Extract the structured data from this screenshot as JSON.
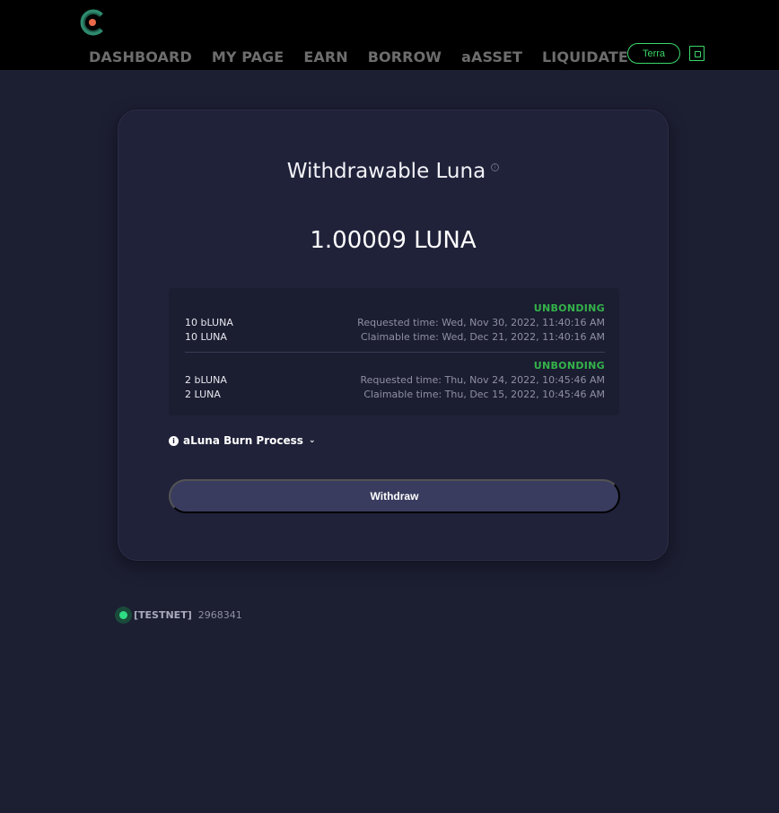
{
  "header": {
    "nav": [
      "DASHBOARD",
      "MY PAGE",
      "EARN",
      "BORROW",
      "aASSET",
      "LIQUIDATE"
    ],
    "network_button": "Terra",
    "accent_color": "#3ad86a"
  },
  "card": {
    "title": "Withdrawable Luna",
    "amount": "1.00009 LUNA",
    "entries": [
      {
        "status": "UNBONDING",
        "rows": [
          {
            "left": "10 bLUNA",
            "right": "Requested time: Wed, Nov 30, 2022, 11:40:16 AM"
          },
          {
            "left": "10 LUNA",
            "right": "Claimable time: Wed, Dec 21, 2022, 11:40:16 AM"
          }
        ]
      },
      {
        "status": "UNBONDING",
        "rows": [
          {
            "left": "2 bLUNA",
            "right": "Requested time: Thu, Nov 24, 2022, 10:45:46 AM"
          },
          {
            "left": "2 LUNA",
            "right": "Claimable time: Thu, Dec 15, 2022, 10:45:46 AM"
          }
        ]
      }
    ],
    "burn_process_label": "aLuna Burn Process",
    "withdraw_label": "Withdraw"
  },
  "footer": {
    "network": "[TESTNET]",
    "block_height": "2968341"
  }
}
